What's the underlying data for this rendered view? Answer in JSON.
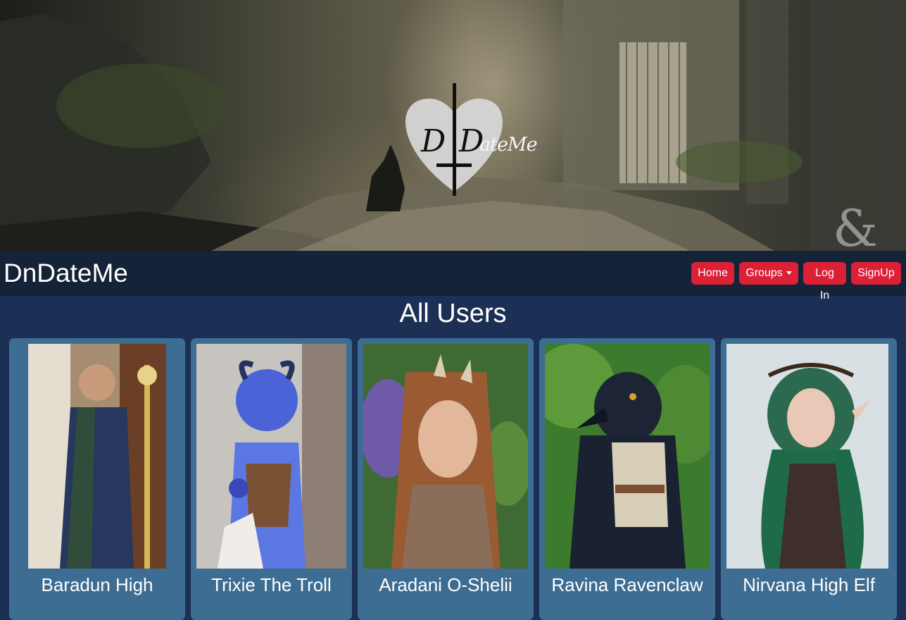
{
  "hero": {
    "logo_letters": "D|D",
    "logo_word": "ateMe",
    "dnd_mark": "&"
  },
  "navbar": {
    "brand": "DnDateMe",
    "home_label": "Home",
    "groups_label": "Groups",
    "login_label": "Log In",
    "signup_label": "SignUp",
    "button_color": "#dc2036",
    "background_color": "#142337"
  },
  "main": {
    "heading": "All Users",
    "background_color": "#1c3055",
    "card_color": "#3d6d93",
    "users": [
      {
        "name": "Baradun High"
      },
      {
        "name": "Trixie The Troll"
      },
      {
        "name": "Aradani O-Shelii"
      },
      {
        "name": "Ravina Ravenclaw"
      },
      {
        "name": "Nirvana High Elf"
      }
    ]
  }
}
